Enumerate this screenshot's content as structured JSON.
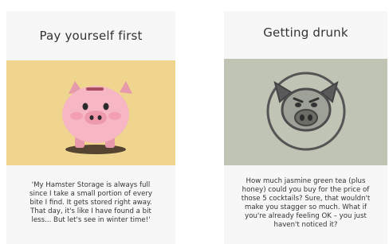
{
  "cards": [
    {
      "title": "Pay yourself first",
      "body": "'My Hamster Storage is always full\nsince I take a small portion of every\nbite I find. It gets stored right away.\nThat day, it's like I have found a bit\nless... But let's see in winter time!'",
      "illustration": "piggy-bank",
      "background_color": "#f0d58e",
      "pig_color": "#f6b6c3"
    },
    {
      "title": "Getting drunk",
      "body": "How much jasmine green tea (plus\nhoney) could you buy for the price of\nthose 5 cocktails? Sure, that wouldn't\nmake you stagger so much. What if\nyou're already feeling OK – you just\nhaven't noticed it?",
      "illustration": "pig-face-outline",
      "background_color": "#bfc4b4",
      "outline_color": "#555555"
    }
  ]
}
